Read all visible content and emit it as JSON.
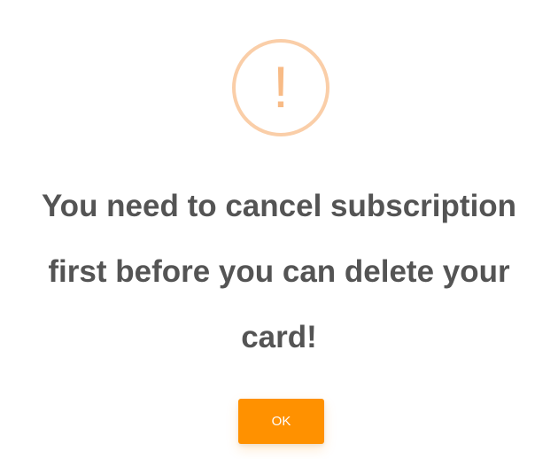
{
  "dialog": {
    "icon": "warning-icon",
    "icon_glyph": "!",
    "title": "You need to cancel subscription first before you can delete your card!",
    "confirm_label": "OK"
  },
  "colors": {
    "icon_border": "#facea8",
    "icon_glyph": "#f8bb86",
    "title_text": "#545454",
    "button_background": "#ff9100",
    "button_text": "#ffffff",
    "background": "#ffffff"
  }
}
